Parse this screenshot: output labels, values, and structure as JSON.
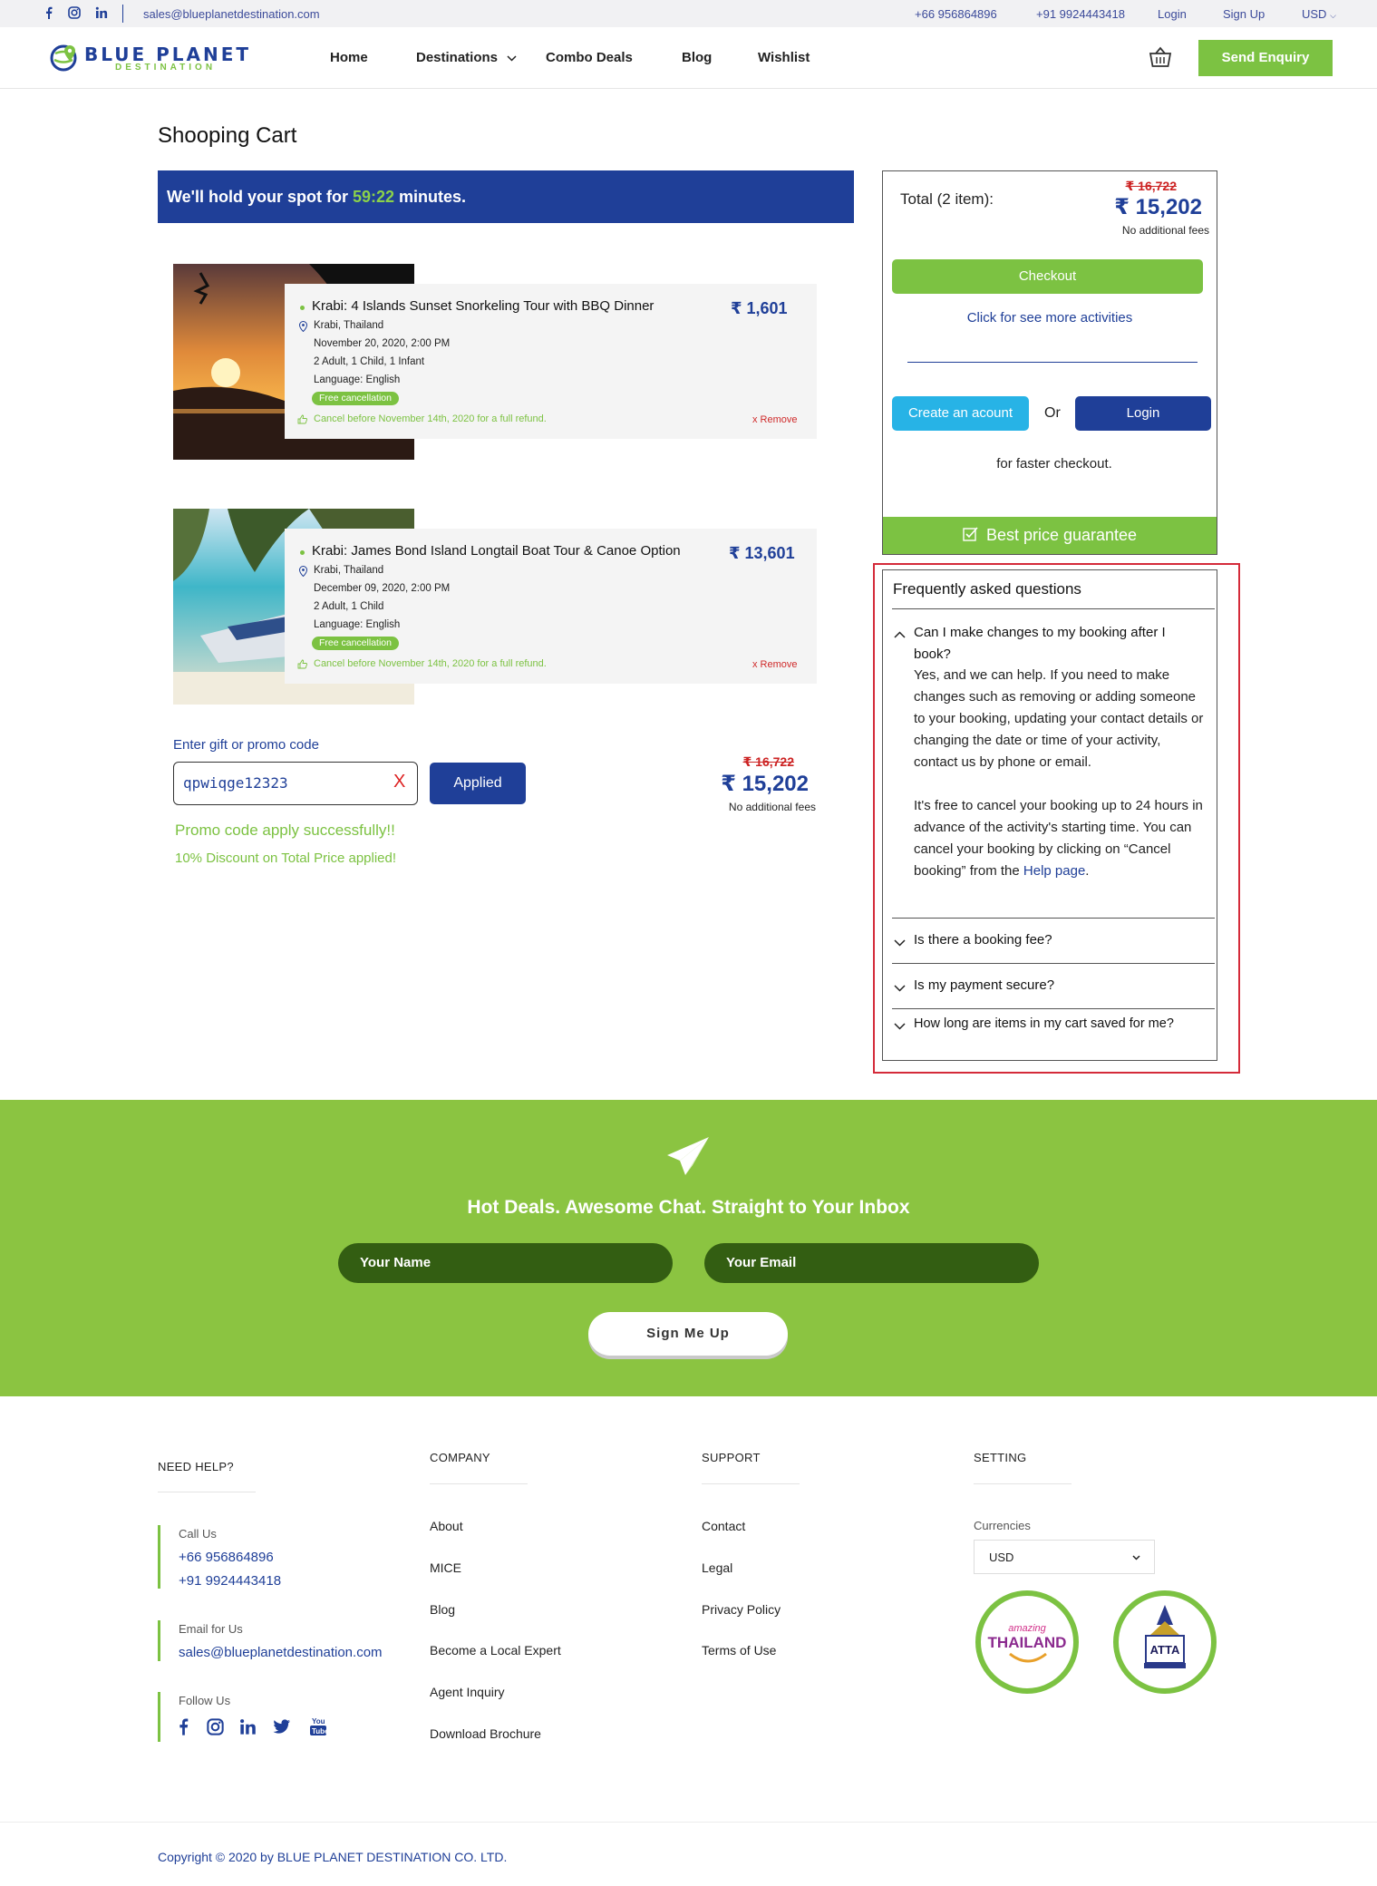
{
  "topbar": {
    "email": "sales@blueplanetdestination.com",
    "phone1": "+66 956864896",
    "phone2": "+91 9924443418",
    "login": "Login",
    "signup": "Sign Up",
    "currency": "USD"
  },
  "header": {
    "logo_word1": "BLUE PLANET",
    "logo_word2": "DESTINATION",
    "nav": [
      "Home",
      "Destinations",
      "Combo Deals",
      "Blog",
      "Wishlist"
    ],
    "send_enquiry": "Send Enquiry"
  },
  "cart": {
    "title": "Shooping Cart",
    "hold_prefix": "We'll hold your spot for",
    "hold_time": "59:22",
    "hold_suffix": "minutes.",
    "items": [
      {
        "title": "Krabi: 4 Islands Sunset Snorkeling Tour with BBQ Dinner",
        "location": "Krabi, Thailand",
        "datetime": "November 20, 2020, 2:00 PM",
        "guests": "2 Adult, 1 Child, 1 Infant",
        "language": "Language: English",
        "badge": "Free cancellation",
        "cancel_note": "Cancel before November 14th, 2020 for a full refund.",
        "price": "₹ 1,601",
        "remove": "x Remove"
      },
      {
        "title": "Krabi: James Bond Island Longtail Boat Tour & Canoe Option",
        "location": "Krabi, Thailand",
        "datetime": "December 09, 2020, 2:00 PM",
        "guests": "2 Adult, 1 Child",
        "language": "Language: English",
        "badge": "Free cancellation",
        "cancel_note": "Cancel before November 14th, 2020 for a full refund.",
        "price": "₹ 13,601",
        "remove": "x Remove"
      }
    ],
    "promo": {
      "label": "Enter gift or promo code",
      "value": "qpwiqge12323",
      "clear": "X",
      "button": "Applied",
      "success": "Promo code apply successfully!!",
      "discount": "10% Discount on Total Price applied!"
    },
    "totals": {
      "old_price": "₹ 16,722",
      "new_price": "₹ 15,202",
      "fees": "No additional fees"
    }
  },
  "summary": {
    "total_label": "Total (2 item):",
    "old_price": "₹ 16,722",
    "new_price": "₹ 15,202",
    "fees": "No additional fees",
    "checkout": "Checkout",
    "more_activities": "Click for see more activities",
    "create_account": "Create an acount",
    "or": "Or",
    "login": "Login",
    "faster": "for faster checkout.",
    "best_price": "Best price guarantee"
  },
  "faq": {
    "title": "Frequently asked questions",
    "q1": "Can I make changes to my booking after I book?",
    "a1_p1": "Yes, and we can help. If you need to make changes such as removing or adding someone to your booking, updating your contact details or changing the date or time of your activity, contact us by phone or email.",
    "a1_p2_pre": "It's free to cancel your booking up to 24 hours in advance of the activity's starting time. You can cancel your booking by clicking on “Cancel booking” from the",
    "a1_p2_link": "Help page",
    "q2": "Is there a booking fee?",
    "q3": "Is my payment secure?",
    "q4": "How long are items in my cart saved for me?"
  },
  "newsletter": {
    "heading": "Hot Deals. Awesome Chat. Straight to Your Inbox",
    "name_placeholder": "Your Name",
    "email_placeholder": "Your Email",
    "button": "Sign Me Up"
  },
  "footer": {
    "help_head": "NEED HELP?",
    "call_label": "Call Us",
    "phone1": "+66 956864896",
    "phone2": "+91 9924443418",
    "email_label": "Email for Us",
    "email": "sales@blueplanetdestination.com",
    "follow_label": "Follow Us",
    "company_head": "COMPANY",
    "company_links": [
      "About",
      "MICE",
      "Blog",
      "Become a Local Expert",
      "Agent Inquiry",
      "Download Brochure"
    ],
    "support_head": "SUPPORT",
    "support_links": [
      "Contact",
      "Legal",
      "Privacy Policy",
      "Terms of Use"
    ],
    "setting_head": "SETTING",
    "currencies_label": "Currencies",
    "currency_value": "USD",
    "badge1_top": "amazing",
    "badge1_main": "THAILAND",
    "badge2_main": "ATTA",
    "copyright": "Copyright © 2020 by BLUE PLANET DESTINATION CO. LTD."
  },
  "colors": {
    "brand_blue": "#1f3f98",
    "brand_green": "#7cc242",
    "newsletter_green": "#8bc441",
    "faq_highlight": "#d42b3a"
  }
}
